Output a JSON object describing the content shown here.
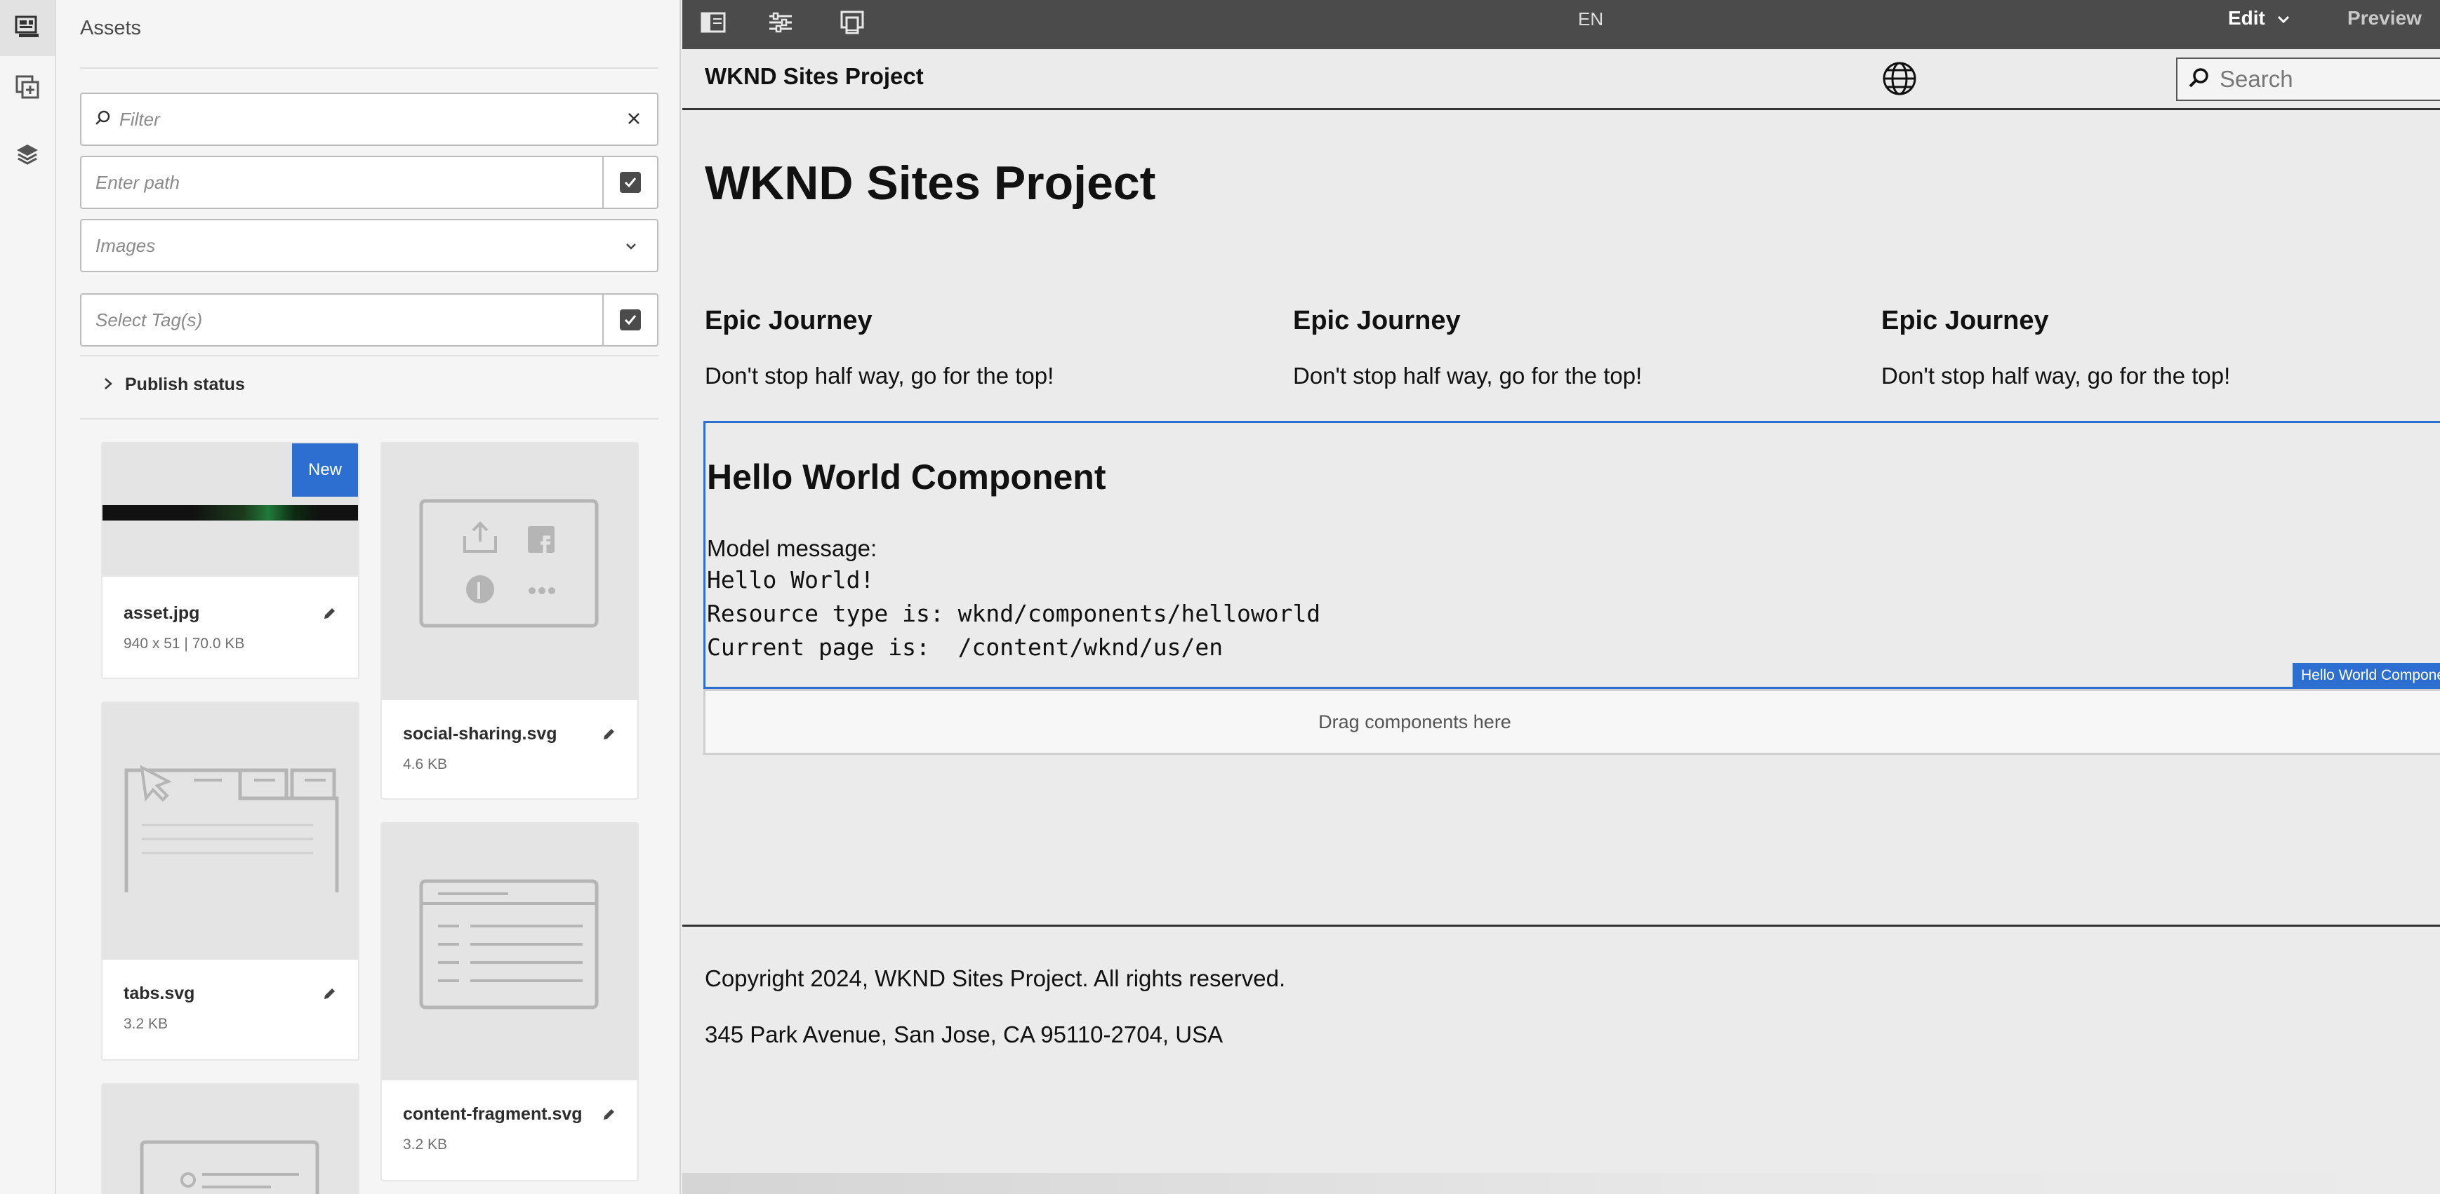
{
  "side_panel": {
    "title": "Assets",
    "filter": {
      "placeholder": "Filter"
    },
    "path": {
      "placeholder": "Enter path"
    },
    "asset_type": {
      "selected": "Images"
    },
    "tags": {
      "placeholder": "Select Tag(s)"
    },
    "publish_status_label": "Publish status",
    "assets": [
      {
        "name": "asset.jpg",
        "meta": "940 x 51 | 70.0 KB",
        "badge": "New"
      },
      {
        "name": "social-sharing.svg",
        "meta": "4.6 KB"
      },
      {
        "name": "tabs.svg",
        "meta": "3.2 KB"
      },
      {
        "name": "content-fragment.svg",
        "meta": "3.2 KB"
      }
    ]
  },
  "toolbar": {
    "language": "EN",
    "edit_label": "Edit",
    "preview_label": "Preview"
  },
  "page": {
    "site_name": "WKND Sites Project",
    "search_placeholder": "Search",
    "heading": "WKND Sites Project",
    "teasers": [
      {
        "title": "Epic Journey",
        "text": "Don't stop half way, go for the top!"
      },
      {
        "title": "Epic Journey",
        "text": "Don't stop half way, go for the top!"
      },
      {
        "title": "Epic Journey",
        "text": "Don't stop half way, go for the top!"
      }
    ],
    "hello_world": {
      "title": "Hello World Component",
      "model_label": "Model message:",
      "lines": [
        "Hello World!",
        "Resource type is: wknd/components/helloworld",
        "Current page is:  /content/wknd/us/en"
      ],
      "component_tag": "Hello World Component"
    },
    "drop_zone_label": "Drag components here",
    "footer": {
      "copyright": "Copyright 2024, WKND Sites Project. All rights reserved.",
      "address": "345 Park Avenue, San Jose, CA 95110-2704, USA"
    }
  },
  "colors": {
    "accent": "#2d6fd0",
    "toolbar_bg": "#4b4b4b",
    "panel_bg": "#f5f5f5",
    "page_bg": "#ebebeb"
  }
}
